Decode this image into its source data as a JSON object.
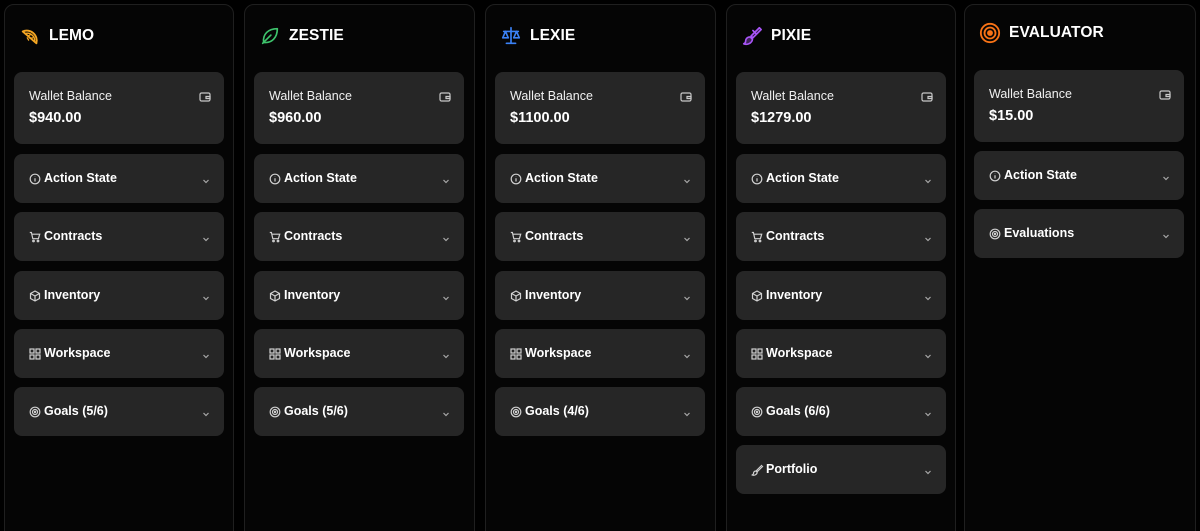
{
  "columns": [
    {
      "id": "lemo",
      "name": "LEMO",
      "icon": "lemon-slice-icon",
      "accent": "#f5a623",
      "wallet": {
        "label": "Wallet Balance",
        "value": "$940.00"
      },
      "sections": [
        {
          "label": "Action State",
          "icon": "info-icon"
        },
        {
          "label": "Contracts",
          "icon": "cart-icon"
        },
        {
          "label": "Inventory",
          "icon": "box-icon"
        },
        {
          "label": "Workspace",
          "icon": "grid-icon"
        },
        {
          "label": "Goals (5/6)",
          "icon": "target-icon"
        }
      ]
    },
    {
      "id": "zestie",
      "name": "ZESTIE",
      "icon": "leaf-icon",
      "accent": "#3ec46d",
      "wallet": {
        "label": "Wallet Balance",
        "value": "$960.00"
      },
      "sections": [
        {
          "label": "Action State",
          "icon": "info-icon"
        },
        {
          "label": "Contracts",
          "icon": "cart-icon"
        },
        {
          "label": "Inventory",
          "icon": "box-icon"
        },
        {
          "label": "Workspace",
          "icon": "grid-icon"
        },
        {
          "label": "Goals (5/6)",
          "icon": "target-icon"
        }
      ]
    },
    {
      "id": "lexie",
      "name": "LEXIE",
      "icon": "scales-icon",
      "accent": "#3b82f6",
      "wallet": {
        "label": "Wallet Balance",
        "value": "$1100.00"
      },
      "sections": [
        {
          "label": "Action State",
          "icon": "info-icon"
        },
        {
          "label": "Contracts",
          "icon": "cart-icon"
        },
        {
          "label": "Inventory",
          "icon": "box-icon"
        },
        {
          "label": "Workspace",
          "icon": "grid-icon"
        },
        {
          "label": "Goals (4/6)",
          "icon": "target-icon"
        }
      ]
    },
    {
      "id": "pixie",
      "name": "PIXIE",
      "icon": "paintbrush-icon",
      "accent": "#a855f7",
      "wallet": {
        "label": "Wallet Balance",
        "value": "$1279.00"
      },
      "sections": [
        {
          "label": "Action State",
          "icon": "info-icon"
        },
        {
          "label": "Contracts",
          "icon": "cart-icon"
        },
        {
          "label": "Inventory",
          "icon": "box-icon"
        },
        {
          "label": "Workspace",
          "icon": "grid-icon"
        },
        {
          "label": "Goals (6/6)",
          "icon": "target-icon"
        },
        {
          "label": "Portfolio",
          "icon": "brush-icon"
        }
      ]
    },
    {
      "id": "evaluator",
      "name": "EVALUATOR",
      "icon": "target-circle-icon",
      "accent": "#f97316",
      "wallet": {
        "label": "Wallet Balance",
        "value": "$15.00"
      },
      "sections": [
        {
          "label": "Action State",
          "icon": "info-icon"
        },
        {
          "label": "Evaluations",
          "icon": "target-icon"
        }
      ]
    }
  ]
}
